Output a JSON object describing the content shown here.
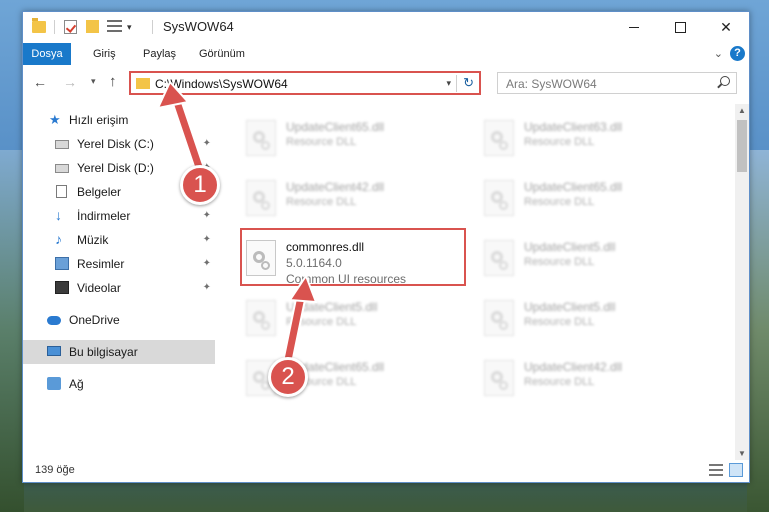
{
  "window": {
    "title": "SysWOW64",
    "quick_access_dropdown": "▾",
    "minimize_glyph": "",
    "maximize_glyph": "",
    "close_glyph": "✕"
  },
  "ribbon": {
    "tabs": [
      {
        "label": "Dosya"
      },
      {
        "label": "Giriş"
      },
      {
        "label": "Paylaş"
      },
      {
        "label": "Görünüm"
      }
    ],
    "expand_glyph": "⌄",
    "help_glyph": "?"
  },
  "navigation": {
    "back_glyph": "←",
    "forward_glyph": "→",
    "recent_glyph": "▾",
    "up_glyph": "↑",
    "address": "C:\\Windows\\SysWOW64",
    "address_dropdown_glyph": "▾",
    "refresh_glyph": "↻",
    "search_placeholder": "Ara: SysWOW64"
  },
  "sidebar": {
    "items": [
      {
        "label": "Hızlı erişim",
        "icon": "star-icon",
        "pinned": false
      },
      {
        "label": "Yerel Disk (C:)",
        "icon": "drive-icon",
        "pinned": true
      },
      {
        "label": "Yerel Disk (D:)",
        "icon": "drive-icon",
        "pinned": true
      },
      {
        "label": "Belgeler",
        "icon": "documents-icon",
        "pinned": true
      },
      {
        "label": "İndirmeler",
        "icon": "downloads-icon",
        "pinned": true
      },
      {
        "label": "Müzik",
        "icon": "music-icon",
        "pinned": true
      },
      {
        "label": "Resimler",
        "icon": "pictures-icon",
        "pinned": true
      },
      {
        "label": "Videolar",
        "icon": "videos-icon",
        "pinned": true
      },
      {
        "label": "OneDrive",
        "icon": "onedrive-icon",
        "pinned": false
      },
      {
        "label": "Bu bilgisayar",
        "icon": "this-pc-icon",
        "pinned": false,
        "selected": true
      },
      {
        "label": "Ağ",
        "icon": "network-icon",
        "pinned": false
      }
    ],
    "pin_glyph": "📌"
  },
  "files": [
    {
      "name": "UpdateClient65.dll",
      "desc": "Resource DLL"
    },
    {
      "name": "UpdateClient63.dll",
      "desc": "Resource DLL"
    },
    {
      "name": "UpdateClient42.dll",
      "desc": "Resource DLL"
    },
    {
      "name": "UpdateClient65.dll",
      "desc": "Resource DLL"
    },
    {
      "name": "commonres.dll",
      "version": "5.0.1164.0",
      "desc": "Common UI resources"
    },
    {
      "name": "UpdateClient5.dll",
      "desc": "Resource DLL"
    },
    {
      "name": "UpdateClient5.dll",
      "desc": "Resource DLL"
    },
    {
      "name": "UpdateClient5.dll",
      "desc": "Resource DLL"
    },
    {
      "name": "UpdateClient65.dll",
      "desc": "Resource DLL"
    },
    {
      "name": "UpdateClient42.dll",
      "desc": "Resource DLL"
    }
  ],
  "scrollbar": {
    "up_glyph": "▲",
    "down_glyph": "▼"
  },
  "status": {
    "item_count": "139 öğe"
  },
  "annotations": {
    "step1": "1",
    "step2": "2",
    "color": "#d9534f"
  }
}
